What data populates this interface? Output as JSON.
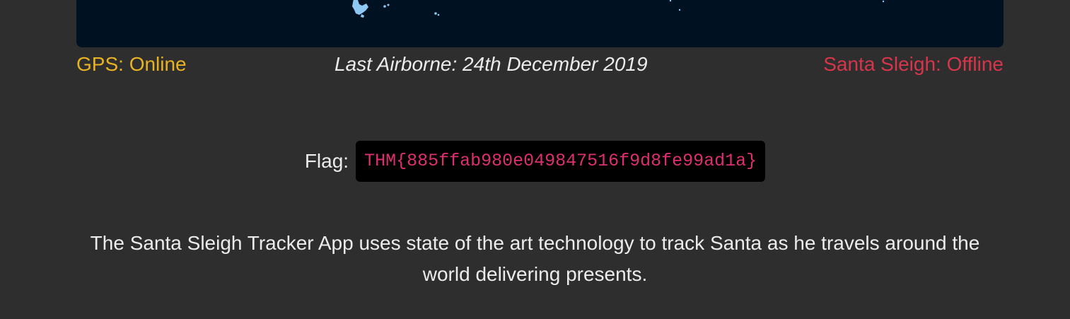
{
  "status": {
    "gps_text": "GPS: Online",
    "last_airborne_text": "Last Airborne: 24th December 2019",
    "sleigh_text": "Santa Sleigh: Offline"
  },
  "flag": {
    "label": "Flag:",
    "value": "THM{885ffab980e049847516f9d8fe99ad1a}"
  },
  "description": "The Santa Sleigh Tracker App uses state of the art technology to track Santa as he travels around the world delivering presents.",
  "colors": {
    "page_bg": "#2e2e2e",
    "map_bg": "#001122",
    "map_land": "#8ec8f2",
    "gps_online": "#e9b223",
    "sleigh_offline": "#d6354b",
    "flag_text": "#dd2f70",
    "flag_bg": "#000000"
  }
}
